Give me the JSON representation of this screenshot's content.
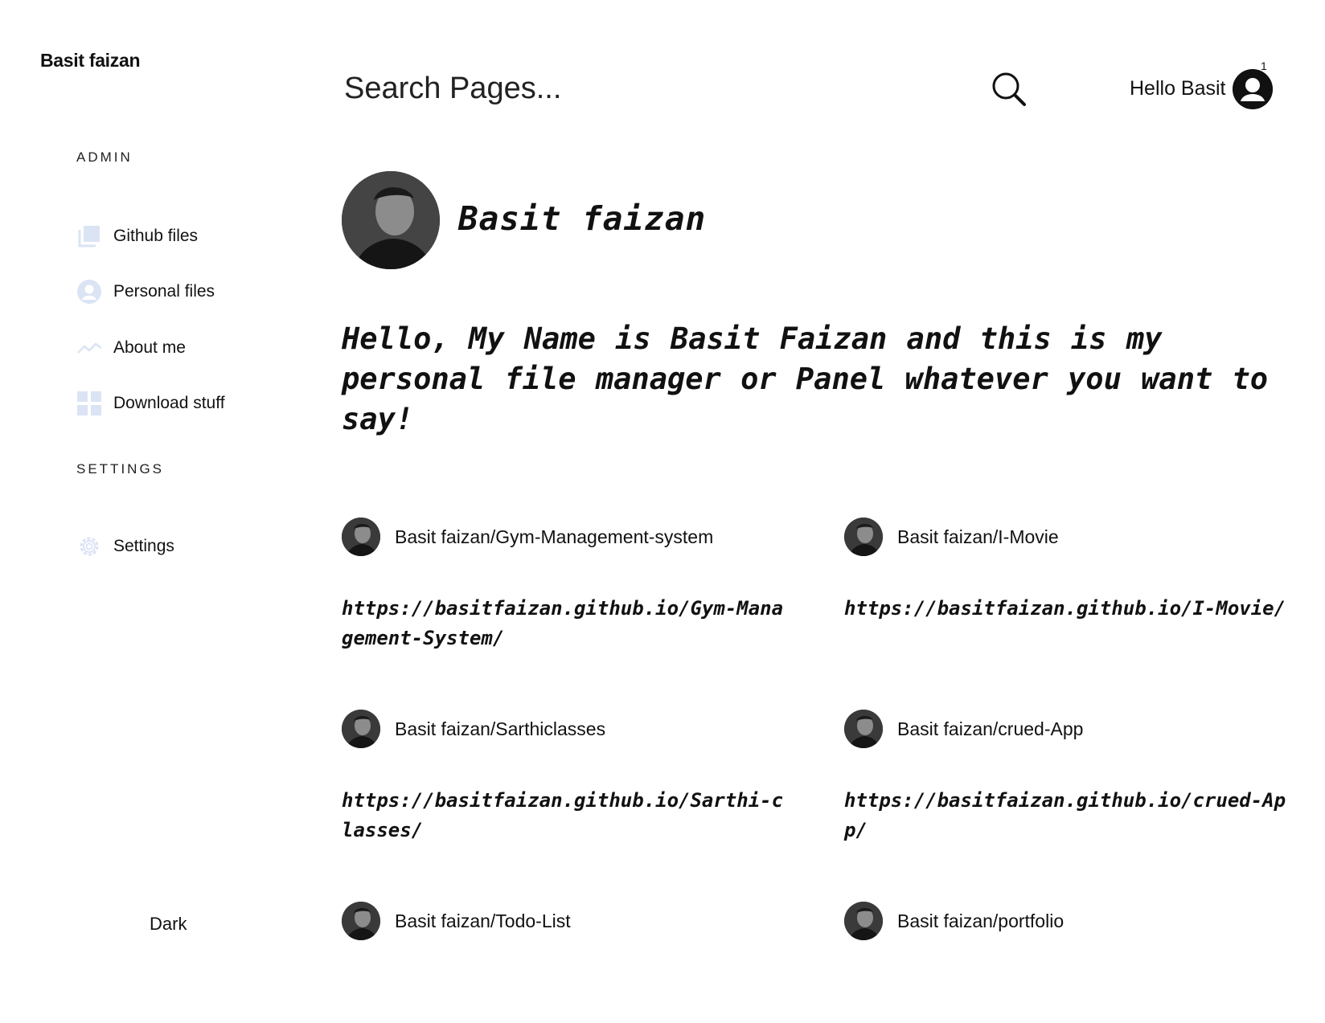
{
  "sidebar": {
    "brand": "Basit faizan",
    "sections": [
      {
        "title": "ADMIN",
        "items": [
          {
            "label": "Github files",
            "icon": "copy-icon"
          },
          {
            "label": "Personal files",
            "icon": "user-circle-icon"
          },
          {
            "label": "About me",
            "icon": "trend-line-icon"
          },
          {
            "label": "Download stuff",
            "icon": "grid-icon"
          }
        ]
      },
      {
        "title": "SETTINGS",
        "items": [
          {
            "label": "Settings",
            "icon": "gear-icon"
          }
        ]
      }
    ],
    "theme_toggle": "Dark"
  },
  "header": {
    "search_placeholder": "Search Pages...",
    "greeting": "Hello Basit",
    "notification_count": "1"
  },
  "profile": {
    "name": "Basit faizan",
    "intro": "Hello, My Name is Basit Faizan and this is my personal file manager or Panel whatever you want to say!"
  },
  "repos": [
    {
      "name": "Basit faizan/Gym-Management-system",
      "link": "https://basitfaizan.github.io/Gym-Management-System/"
    },
    {
      "name": "Basit faizan/I-Movie",
      "link": "https://basitfaizan.github.io/I-Movie/"
    },
    {
      "name": "Basit faizan/Sarthiclasses",
      "link": "https://basitfaizan.github.io/Sarthi-classes/"
    },
    {
      "name": "Basit faizan/crued-App",
      "link": "https://basitfaizan.github.io/crued-App/"
    },
    {
      "name": "Basit faizan/Todo-List",
      "link": ""
    },
    {
      "name": "Basit faizan/portfolio",
      "link": ""
    }
  ],
  "colors": {
    "icon_tint": "#dbe4f4",
    "text": "#111111",
    "background": "#ffffff"
  }
}
